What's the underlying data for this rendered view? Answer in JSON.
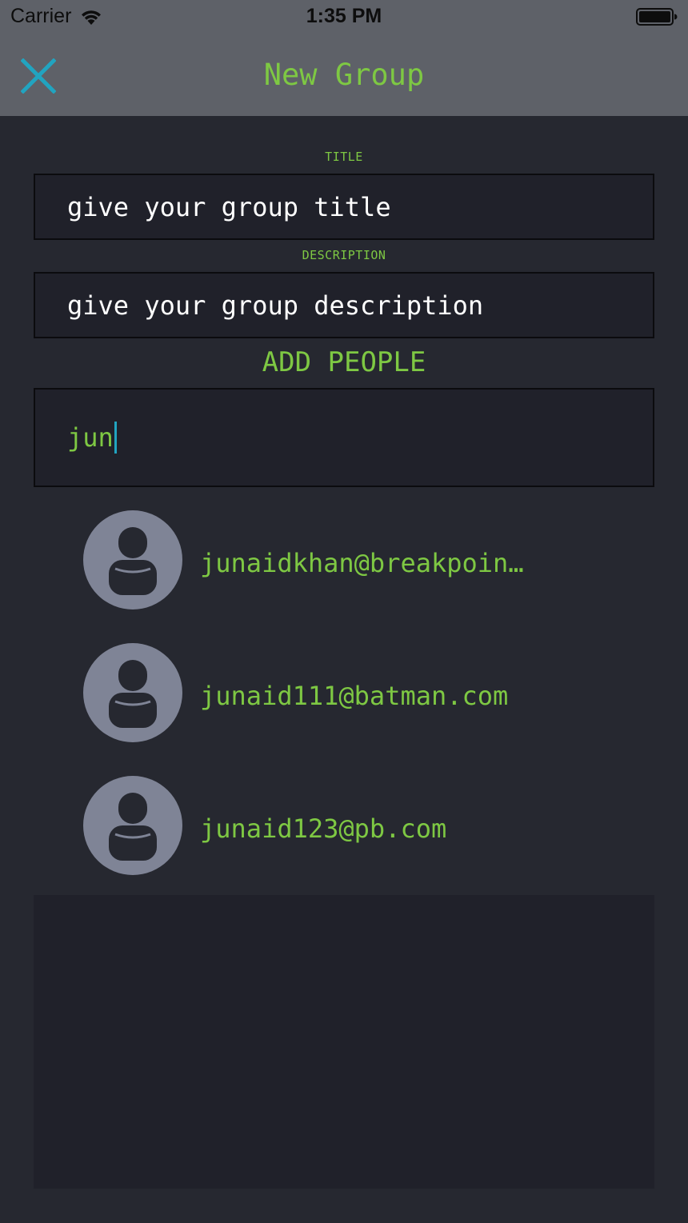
{
  "status_bar": {
    "carrier": "Carrier",
    "time": "1:35 PM",
    "wifi_icon": "wifi-icon",
    "battery_icon": "battery-icon"
  },
  "nav": {
    "title": "New Group",
    "close_icon": "close-icon"
  },
  "form": {
    "title_label": "TITLE",
    "title_placeholder": "give your group title",
    "description_label": "DESCRIPTION",
    "description_placeholder": "give your group description"
  },
  "add_people": {
    "heading": "ADD PEOPLE",
    "search_value": "jun"
  },
  "results": [
    {
      "email": "junaidkhan@breakpoint.com",
      "email_display": "junaidkhan@breakpoin…"
    },
    {
      "email": "junaid111@batman.com"
    },
    {
      "email": "junaid123@pb.com"
    }
  ],
  "colors": {
    "accent_green": "#7ec843",
    "close_blue": "#21a4c0",
    "nav_background": "#5e6168",
    "page_background": "#262830",
    "field_background": "#20212a",
    "avatar_grey": "#7f8496"
  }
}
